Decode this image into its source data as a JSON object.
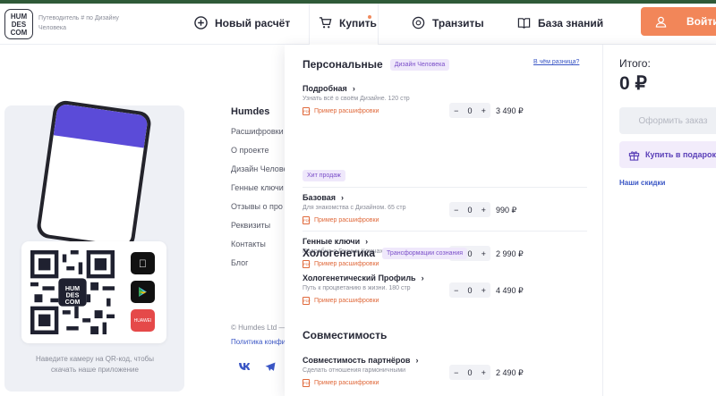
{
  "header": {
    "logo_text": "HUM DES COM",
    "tagline": "Путеводитель # по Дизайну Человека",
    "nav": [
      {
        "label": "Новый расчёт"
      },
      {
        "label": "Купить"
      },
      {
        "label": "Транзиты"
      },
      {
        "label": "База знаний"
      }
    ],
    "login_label": "Войти"
  },
  "background": {
    "camera_text": "Наведите камеру на QR-код, чтобы скачать наше приложение",
    "footer_title": "Humdes",
    "footer_links": [
      "Расшифровки",
      "О проекте",
      "Дизайн Челове",
      "Генные ключи",
      "Отзывы о про",
      "Реквизиты",
      "Контакты",
      "Блог"
    ],
    "copyright": "© Humdes Ltd —",
    "policy": "Политика конфи",
    "social": [
      "VK",
      "TG"
    ],
    "store_labels": [
      "",
      "",
      "HUAWEI"
    ]
  },
  "dropdown": {
    "sections": [
      {
        "title": "Персональные",
        "chip": "Дизайн Человека"
      },
      {
        "title": "Хологенетика",
        "chip": "Трансформации сознания"
      },
      {
        "title": "Совместимость",
        "chip": ""
      }
    ],
    "diff_link": "В чём разница?",
    "hit_badge": "Хит продаж",
    "example_label": "Пример расшифровки",
    "products": [
      {
        "name": "Подробная",
        "desc": "Узнать всё о своём Дизайне. 120 стр",
        "qty": "0",
        "price": "3 490 ₽"
      },
      {
        "name": "Базовая",
        "desc": "Для знакомства с Дизайном. 65 стр",
        "qty": "0",
        "price": "990 ₽"
      },
      {
        "name": "Генные ключи",
        "desc": "Подробно о Генных Ключах. 75 стр",
        "qty": "0",
        "price": "2 990 ₽"
      },
      {
        "name": "Хологенетический Профиль",
        "desc": "Путь к процветанию в жизни. 180 стр",
        "qty": "0",
        "price": "4 490 ₽"
      },
      {
        "name": "Совместимость партнёров",
        "desc": "Сделать отношения гармоничными",
        "qty": "0",
        "price": "2 490 ₽"
      }
    ],
    "total_label": "Итого:",
    "total_value": "0 ₽",
    "checkout_label": "Оформить заказ",
    "gift_label": "Купить в подарок",
    "discounts_label": "Наши скидки"
  },
  "colors": {
    "accent": "#f28659",
    "brand_purple": "#7b4fc9",
    "link_blue": "#3a56c5"
  }
}
